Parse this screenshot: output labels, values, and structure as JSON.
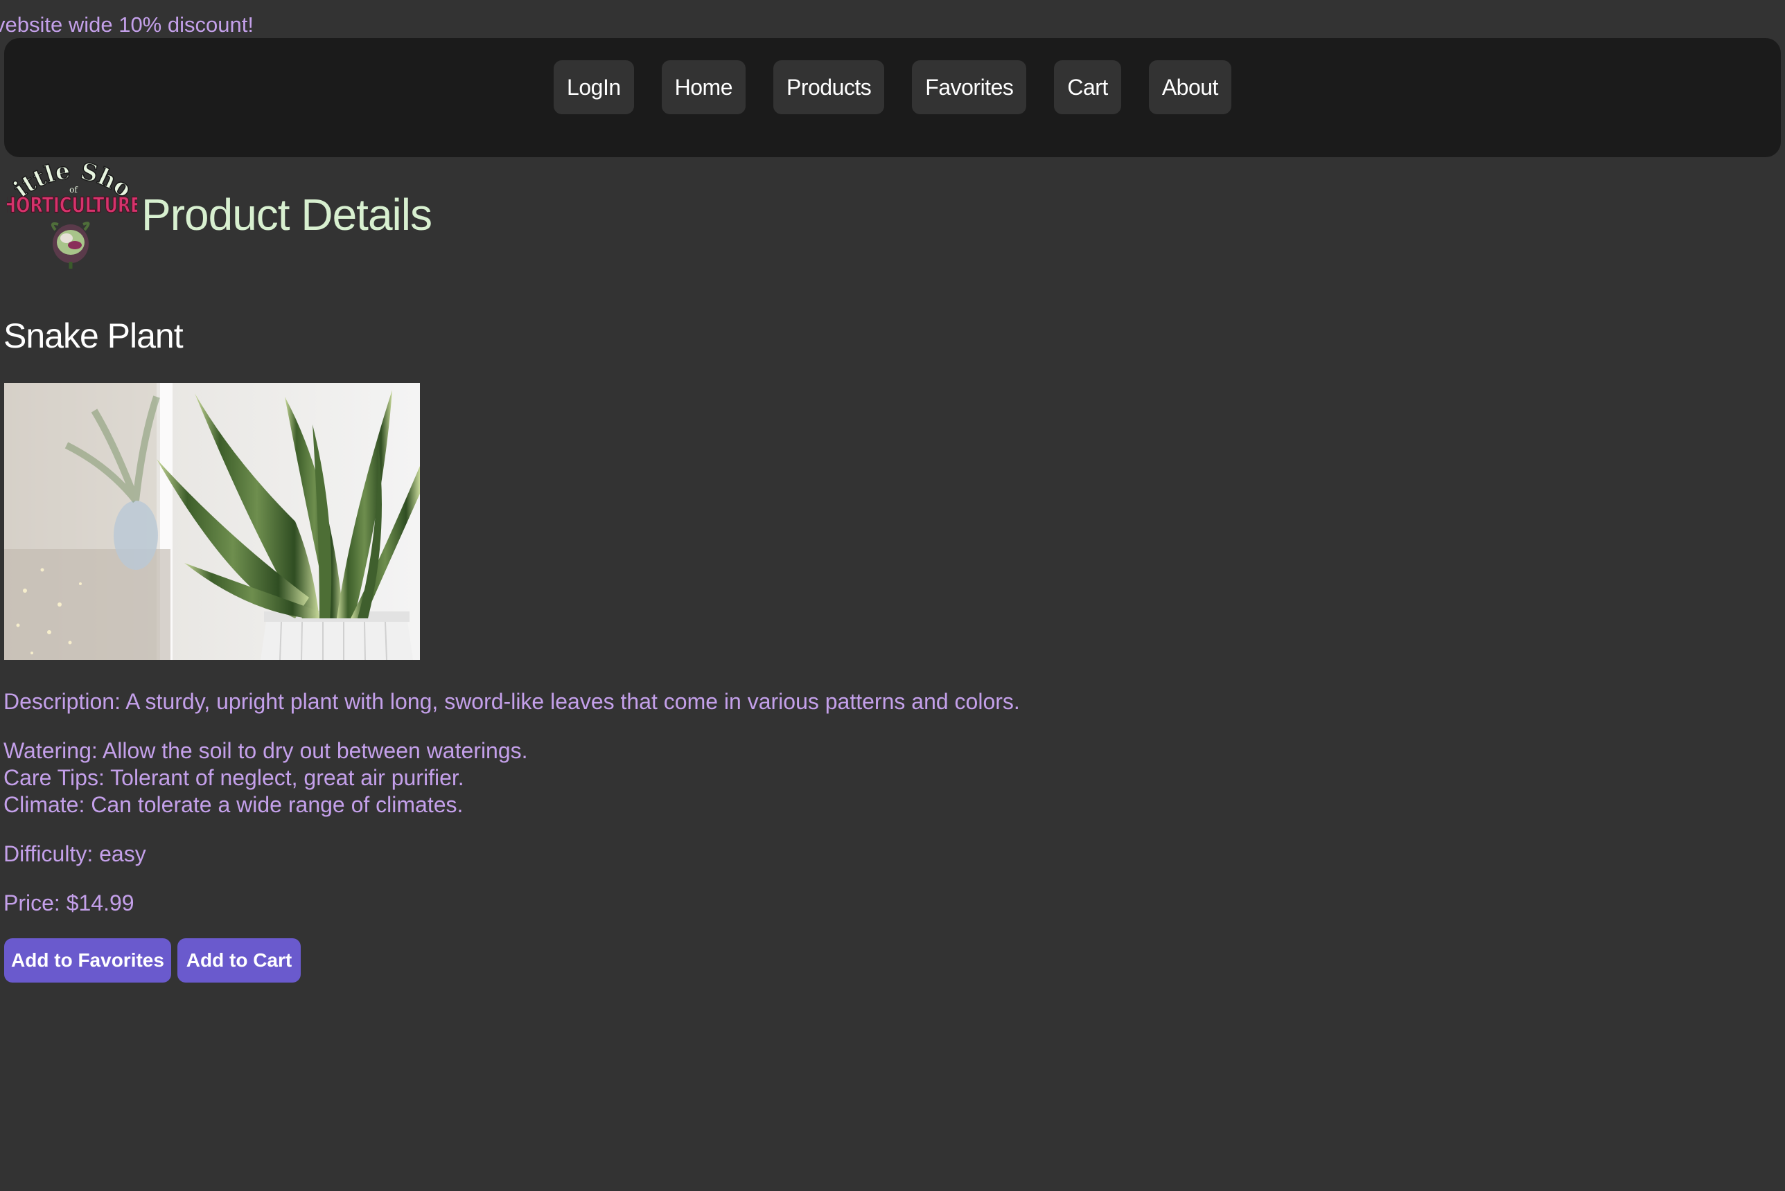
{
  "banner": {
    "text": "vebsite wide 10% discount!"
  },
  "nav": {
    "items": [
      {
        "label": "LogIn"
      },
      {
        "label": "Home"
      },
      {
        "label": "Products"
      },
      {
        "label": "Favorites"
      },
      {
        "label": "Cart"
      },
      {
        "label": "About"
      }
    ]
  },
  "logo": {
    "line1": "Little Shop",
    "line2": "of",
    "line3": "HORTICULTURE"
  },
  "header": {
    "title": "Product Details"
  },
  "product": {
    "name": "Snake Plant",
    "description": "Description: A sturdy, upright plant with long, sword-like leaves that come in various patterns and colors.",
    "watering": "Watering: Allow the soil to dry out between waterings.",
    "care_tips": "Care Tips: Tolerant of neglect, great air purifier.",
    "climate": "Climate: Can tolerate a wide range of climates.",
    "difficulty": "Difficulty: easy",
    "price": "Price: $14.99"
  },
  "actions": {
    "favorites_label": "Add to Favorites",
    "cart_label": "Add to Cart"
  },
  "colors": {
    "background": "#333333",
    "navbar": "#1b1b1b",
    "accent_text": "#c4a0ea",
    "title_text": "#d8f0d0",
    "button": "#6a5acd"
  }
}
